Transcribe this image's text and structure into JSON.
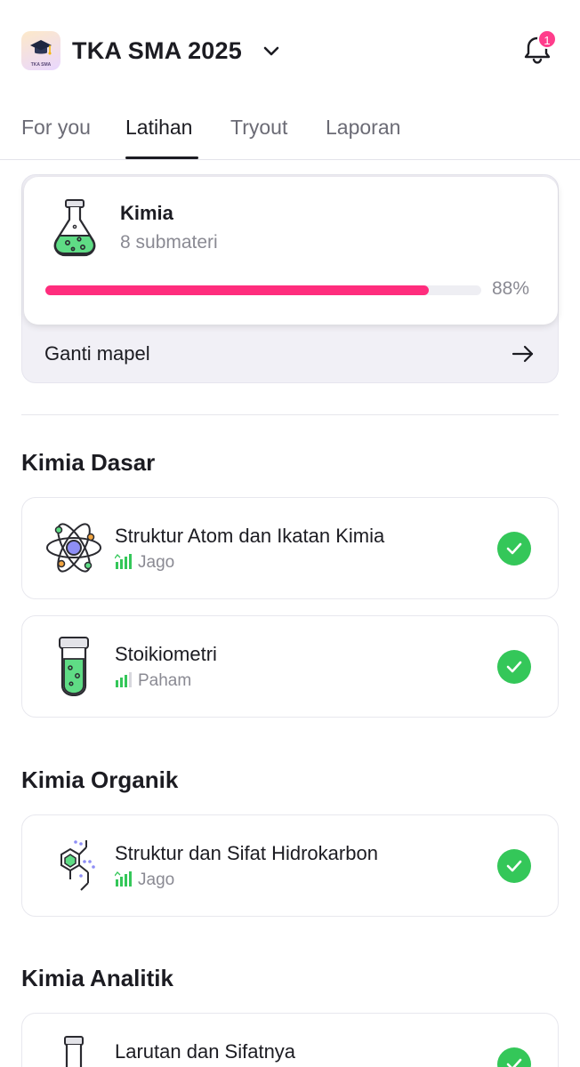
{
  "header": {
    "app_title": "TKA SMA 2025",
    "logo_label": "TKA SMA",
    "notification_count": "1"
  },
  "tabs": [
    {
      "label": "For you",
      "active": false
    },
    {
      "label": "Latihan",
      "active": true
    },
    {
      "label": "Tryout",
      "active": false
    },
    {
      "label": "Laporan",
      "active": false
    }
  ],
  "subject": {
    "name": "Kimia",
    "submateri": "8 submateri",
    "progress_pct": 88,
    "progress_text": "88%",
    "change_label": "Ganti mapel"
  },
  "sections": [
    {
      "title": "Kimia Dasar",
      "topics": [
        {
          "name": "Struktur Atom dan Ikatan Kimia",
          "level": "Jago",
          "icon": "atom-icon",
          "completed": true
        },
        {
          "name": "Stoikiometri",
          "level": "Paham",
          "icon": "test-tube-icon",
          "completed": true
        }
      ]
    },
    {
      "title": "Kimia Organik",
      "topics": [
        {
          "name": "Struktur dan Sifat Hidrokarbon",
          "level": "Jago",
          "icon": "molecule-icon",
          "completed": true
        }
      ]
    },
    {
      "title": "Kimia Analitik",
      "topics": [
        {
          "name": "Larutan dan Sifatnya",
          "level": "",
          "icon": "test-tube-icon",
          "completed": true
        }
      ]
    }
  ],
  "colors": {
    "accent": "#ff2d7d",
    "success": "#34c759",
    "level_green": "#34c759"
  }
}
